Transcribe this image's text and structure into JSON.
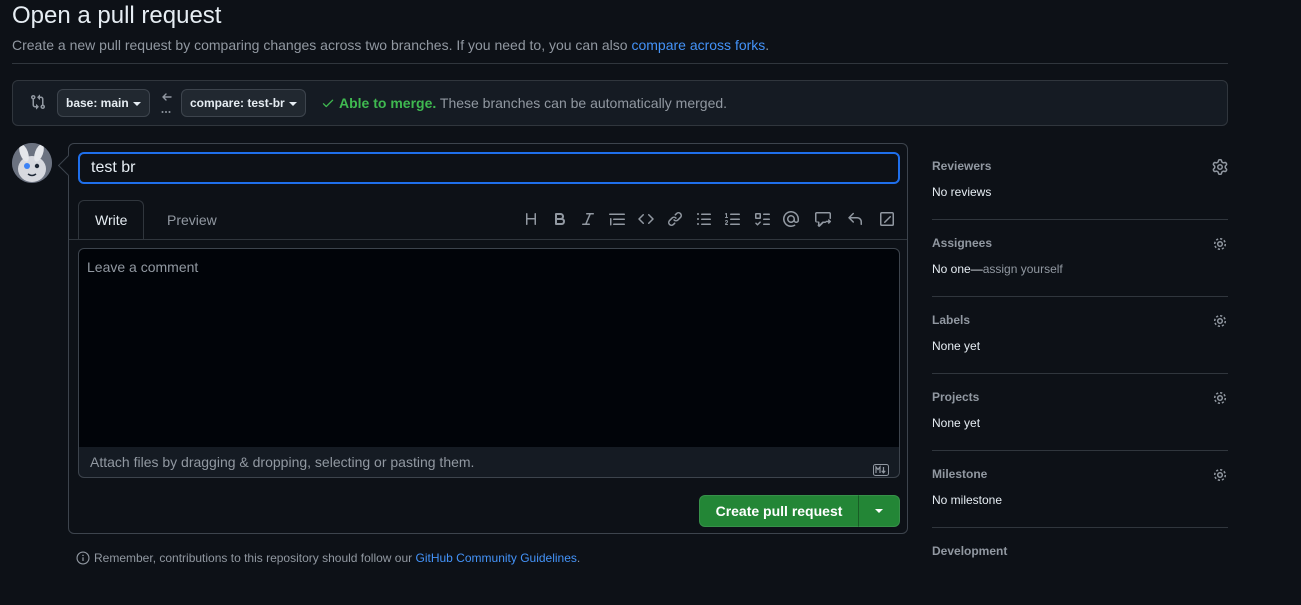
{
  "page": {
    "title": "Open a pull request",
    "subtitle_text": "Create a new pull request by comparing changes across two branches. If you need to, you can also ",
    "subtitle_link": "compare across forks",
    "subtitle_end": "."
  },
  "range": {
    "base_label": "base: main",
    "compare_label": "compare: test-br",
    "merge_ok": "Able to merge.",
    "merge_msg": " These branches can be automatically merged."
  },
  "form": {
    "title_value": "test br",
    "tabs": [
      {
        "label": "Write"
      },
      {
        "label": "Preview"
      }
    ],
    "comment_placeholder": "Leave a comment",
    "attach_text": "Attach files by dragging & dropping, selecting or pasting them.",
    "submit_label": "Create pull request"
  },
  "guidelines": {
    "text": "Remember, contributions to this repository should follow our ",
    "link": "GitHub Community Guidelines",
    "end": "."
  },
  "sidebar": {
    "reviewers": {
      "heading": "Reviewers",
      "value": "No reviews"
    },
    "assignees": {
      "heading": "Assignees",
      "value": "No one—",
      "link": "assign yourself"
    },
    "labels": {
      "heading": "Labels",
      "value": "None yet"
    },
    "projects": {
      "heading": "Projects",
      "value": "None yet"
    },
    "milestone": {
      "heading": "Milestone",
      "value": "No milestone"
    },
    "development": {
      "heading": "Development"
    }
  },
  "colors": {
    "background": "#0d1117",
    "accent": "#4493f8",
    "success": "#3fb950",
    "primary_button": "#238636"
  },
  "toolbar_icons": [
    "heading-icon",
    "bold-icon",
    "italic-icon",
    "quote-icon",
    "code-icon",
    "link-icon",
    "unordered-list-icon",
    "ordered-list-icon",
    "task-list-icon",
    "mention-icon",
    "reference-icon",
    "reply-icon",
    "slash-command-icon"
  ]
}
